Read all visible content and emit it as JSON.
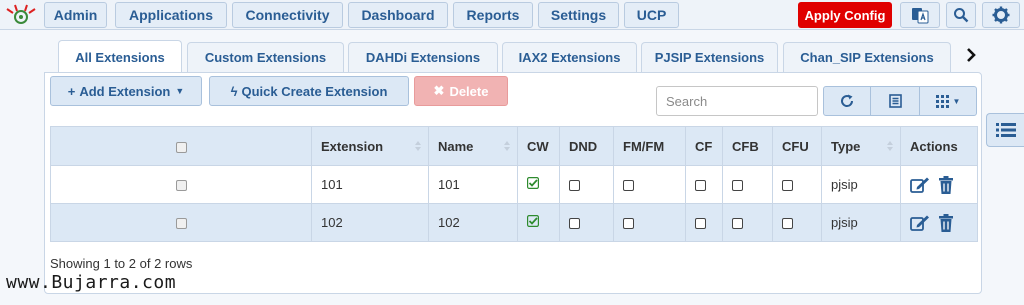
{
  "nav": {
    "items": [
      "Admin",
      "Applications",
      "Connectivity",
      "Dashboard",
      "Reports",
      "Settings",
      "UCP"
    ],
    "apply_config": "Apply Config",
    "icons": [
      "language-icon",
      "search-icon",
      "gear-icon"
    ]
  },
  "tabs": [
    "All Extensions",
    "Custom Extensions",
    "DAHDi Extensions",
    "IAX2 Extensions",
    "PJSIP Extensions",
    "Chan_SIP Extensions"
  ],
  "toolbar": {
    "add_extension": "Add Extension",
    "quick_create": "Quick Create Extension",
    "delete": "Delete",
    "search_placeholder": "Search"
  },
  "table": {
    "columns": [
      "",
      "Extension",
      "Name",
      "CW",
      "DND",
      "FM/FM",
      "CF",
      "CFB",
      "CFU",
      "Type",
      "Actions"
    ],
    "rows": [
      {
        "extension": "101",
        "name": "101",
        "cw": true,
        "dnd": false,
        "fmfm": false,
        "cf": false,
        "cfb": false,
        "cfu": false,
        "type": "pjsip"
      },
      {
        "extension": "102",
        "name": "102",
        "cw": true,
        "dnd": false,
        "fmfm": false,
        "cf": false,
        "cfb": false,
        "cfu": false,
        "type": "pjsip"
      }
    ]
  },
  "footer": {
    "showing": "Showing 1 to 2 of 2 rows"
  },
  "watermark": "www.Bujarra.com",
  "colors": {
    "accent": "#2a5d94",
    "apply": "#e00000",
    "row_alt": "#dce8f5",
    "check_green": "#2e8b2e"
  }
}
